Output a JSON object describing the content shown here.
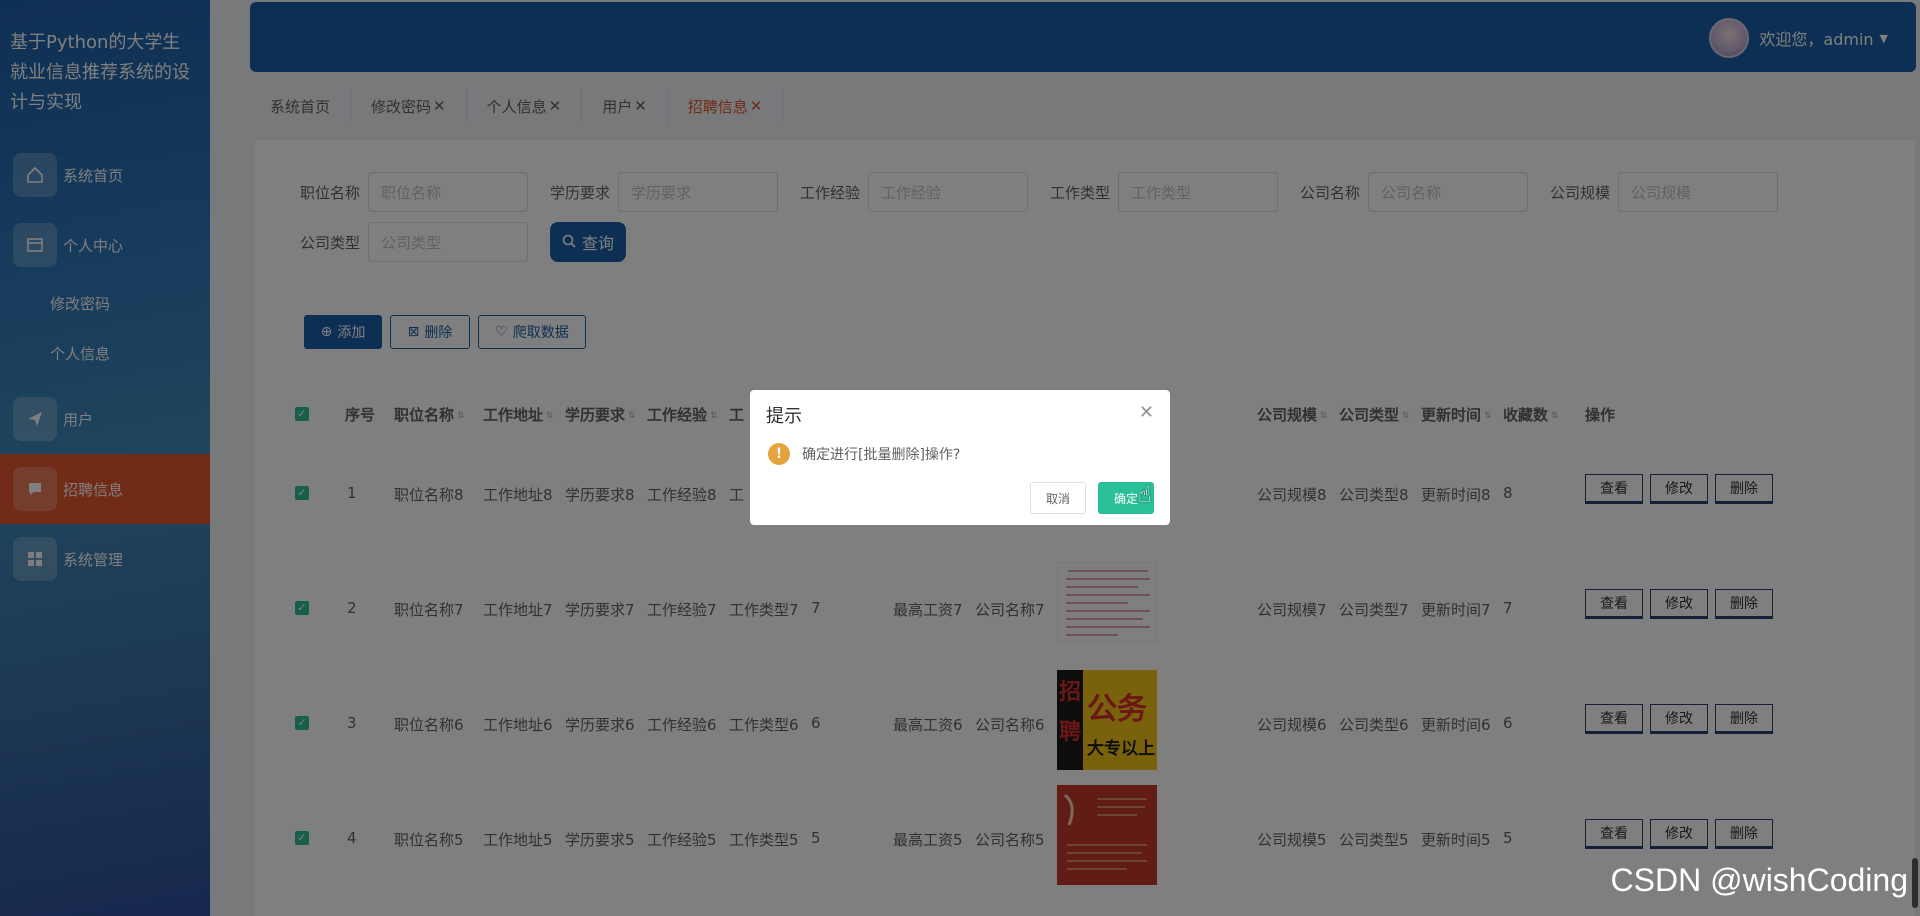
{
  "sidebar": {
    "title": "基于Python的大学生就业信息推荐系统的设计与实现",
    "items": [
      {
        "label": "系统首页",
        "icon": "home-icon"
      },
      {
        "label": "个人中心",
        "icon": "card-icon"
      },
      {
        "label": "修改密码"
      },
      {
        "label": "个人信息"
      },
      {
        "label": "用户",
        "icon": "send-icon"
      },
      {
        "label": "招聘信息",
        "icon": "chat-icon"
      },
      {
        "label": "系统管理",
        "icon": "grid-icon"
      }
    ]
  },
  "header": {
    "welcome": "欢迎您，admin"
  },
  "tabs": [
    {
      "label": "系统首页"
    },
    {
      "label": "修改密码",
      "close": "✕"
    },
    {
      "label": "个人信息",
      "close": "✕"
    },
    {
      "label": "用户",
      "close": "✕"
    },
    {
      "label": "招聘信息",
      "close": "✕"
    }
  ],
  "search": {
    "fields": [
      {
        "label": "职位名称",
        "placeholder": "职位名称"
      },
      {
        "label": "学历要求",
        "placeholder": "学历要求"
      },
      {
        "label": "工作经验",
        "placeholder": "工作经验"
      },
      {
        "label": "工作类型",
        "placeholder": "工作类型"
      },
      {
        "label": "公司名称",
        "placeholder": "公司名称"
      },
      {
        "label": "公司规模",
        "placeholder": "公司规模"
      },
      {
        "label": "公司类型",
        "placeholder": "公司类型"
      }
    ],
    "query_label": "查询"
  },
  "actions": {
    "add": "添加",
    "delete": "删除",
    "crawl": "爬取数据"
  },
  "table": {
    "headers": [
      "序号",
      "职位名称",
      "工作地址",
      "学历要求",
      "工作经验",
      "工",
      "公司规模",
      "公司类型",
      "更新时间",
      "收藏数",
      "操作"
    ],
    "rows": [
      {
        "idx": "1",
        "name": "职位名称8",
        "addr": "工作地址8",
        "edu": "学历要求8",
        "exp": "工作经验8",
        "type": "工",
        "num": "",
        "salary": "",
        "company": "",
        "scale": "公司规模8",
        "ctype": "公司类型8",
        "time": "更新时间8",
        "fav": "8"
      },
      {
        "idx": "2",
        "name": "职位名称7",
        "addr": "工作地址7",
        "edu": "学历要求7",
        "exp": "工作经验7",
        "type": "工作类型7",
        "num": "7",
        "salary": "最高工资7",
        "company": "公司名称7",
        "scale": "公司规模7",
        "ctype": "公司类型7",
        "time": "更新时间7",
        "fav": "7"
      },
      {
        "idx": "3",
        "name": "职位名称6",
        "addr": "工作地址6",
        "edu": "学历要求6",
        "exp": "工作经验6",
        "type": "工作类型6",
        "num": "6",
        "salary": "最高工资6",
        "company": "公司名称6",
        "scale": "公司规模6",
        "ctype": "公司类型6",
        "time": "更新时间6",
        "fav": "6"
      },
      {
        "idx": "4",
        "name": "职位名称5",
        "addr": "工作地址5",
        "edu": "学历要求5",
        "exp": "工作经验5",
        "type": "工作类型5",
        "num": "5",
        "salary": "最高工资5",
        "company": "公司名称5",
        "scale": "公司规模5",
        "ctype": "公司类型5",
        "time": "更新时间5",
        "fav": "5"
      }
    ],
    "ops": [
      "查看",
      "修改",
      "删除"
    ],
    "poster_gongwu": "公务",
    "poster_zhao": "招",
    "poster_pin": "聘",
    "poster_dazhuan": "大专以上"
  },
  "dialog": {
    "title": "提示",
    "message": "确定进行[批量删除]操作?",
    "cancel": "取消",
    "confirm": "确定"
  },
  "watermark": "CSDN @wishCoding",
  "colors": {
    "primary": "#1d5fa8",
    "active": "#e4572e",
    "success": "#2bbf98",
    "warning": "#e6a23c"
  }
}
